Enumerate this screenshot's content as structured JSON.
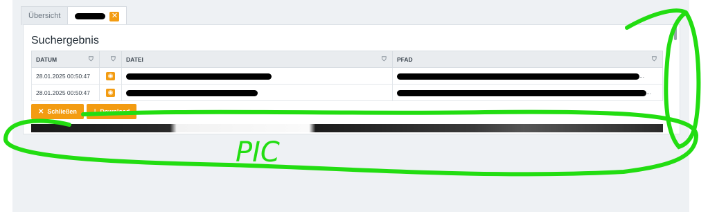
{
  "tabs": [
    {
      "label": "Übersicht"
    },
    {
      "label": "",
      "redacted": true,
      "close_icon": "close-icon"
    }
  ],
  "panel": {
    "title": "Suchergebnis"
  },
  "table": {
    "columns": [
      "DATUM",
      "",
      "DATEI",
      "PFAD"
    ],
    "rows": [
      {
        "datum": "28.01.2025 00:50:47",
        "datei_redacted": true,
        "pfad_redacted": true,
        "pfad_suffix": "..."
      },
      {
        "datum": "28.01.2025 00:50:47",
        "datei_redacted": true,
        "pfad_redacted": true,
        "pfad_suffix": "..."
      }
    ]
  },
  "buttons": {
    "close_label": "Schließen",
    "download_label": "Download"
  },
  "annotation": {
    "text": "PIC",
    "color": "#22dd11"
  },
  "colors": {
    "accent": "#f39c12",
    "annotation": "#22dd11"
  }
}
